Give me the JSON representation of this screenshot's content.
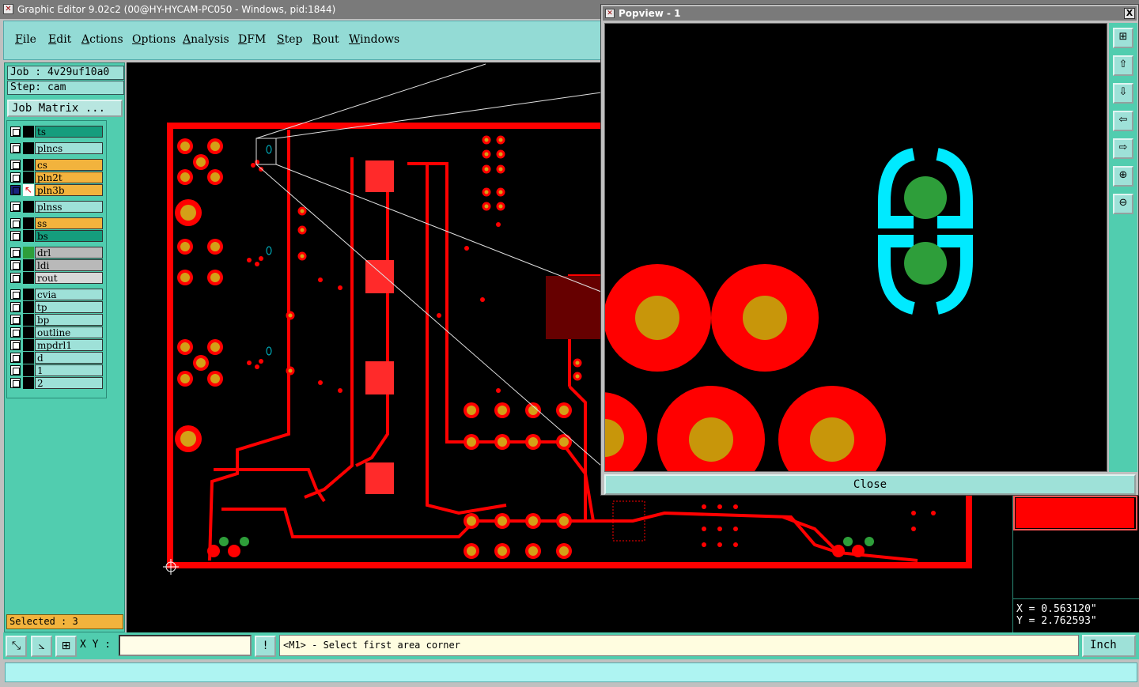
{
  "window": {
    "title": "Graphic Editor 9.02c2 (00@HY-HYCAM-PC050 - Windows, pid:1844)"
  },
  "menu": [
    "File",
    "Edit",
    "Actions",
    "Options",
    "Analysis",
    "DFM",
    "Step",
    "Rout",
    "Windows"
  ],
  "job": {
    "job_label": "Job : 4v29uf10a0",
    "step_label": "Step: cam",
    "matrix_button": "Job Matrix ..."
  },
  "layers": [
    {
      "name": "ts",
      "color": "#159d7d"
    },
    {
      "name": "plncs",
      "color": "#9ee1d8"
    },
    {
      "name": "cs",
      "color": "#f2b33d"
    },
    {
      "name": "pln2t",
      "color": "#f2b33d"
    },
    {
      "name": "pln3b",
      "color": "#f2b33d"
    },
    {
      "name": "plnss",
      "color": "#9ee1d8"
    },
    {
      "name": "ss",
      "color": "#f2b33d"
    },
    {
      "name": "bs",
      "color": "#159d7d"
    },
    {
      "name": "drl",
      "color": "#b9b9b9"
    },
    {
      "name": "ldi",
      "color": "#b9b9b9"
    },
    {
      "name": "rout",
      "color": "#d8d8d8"
    },
    {
      "name": "cvia",
      "color": "#9ee1d8"
    },
    {
      "name": "tp",
      "color": "#9ee1d8"
    },
    {
      "name": "bp",
      "color": "#9ee1d8"
    },
    {
      "name": "outline",
      "color": "#9ee1d8"
    },
    {
      "name": "mpdrl1",
      "color": "#9ee1d8"
    },
    {
      "name": "d",
      "color": "#9ee1d8"
    },
    {
      "name": "1",
      "color": "#9ee1d8"
    },
    {
      "name": "2",
      "color": "#9ee1d8"
    }
  ],
  "selected_text": "Selected : 3",
  "coords": {
    "x": "X = 0.563120\"",
    "y": "Y = 2.762593\""
  },
  "popview": {
    "title": "Popview - 1",
    "close_label": "Close",
    "close_x": "X"
  },
  "bottom": {
    "xy_label": "X Y :",
    "xy_value": "",
    "prompt": "<M1> - Select first area corner",
    "unit": "Inch"
  },
  "colors": {
    "accent": "#51cdaf",
    "pcb_copper": "#ff0000",
    "pcb_pad": "#d4a017",
    "highlight": "#00ffff"
  }
}
